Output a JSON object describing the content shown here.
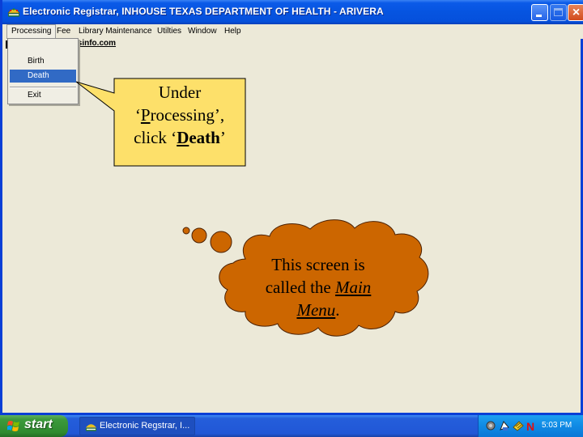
{
  "window": {
    "title": "Electronic Registrar, INHOUSE TEXAS DEPARTMENT OF HEALTH - ARIVERA",
    "controls": {
      "minimize": "minimize",
      "maximize": "maximize",
      "close": "×"
    }
  },
  "menubar": {
    "items": [
      {
        "label": "Processing",
        "active": true
      },
      {
        "label": "Fee"
      },
      {
        "label": "Library Maintenance"
      },
      {
        "label": "Utilties"
      },
      {
        "label": "Window"
      },
      {
        "label": "Help"
      }
    ]
  },
  "background_link": "isinfo.com",
  "dropdown": {
    "items": [
      {
        "label": "Birth",
        "selected": false
      },
      {
        "label": "Death",
        "selected": true
      },
      {
        "label": "Exit",
        "selected": false
      }
    ]
  },
  "callout": {
    "line1": "Under",
    "line2_quote_open": "‘",
    "line2_underlined": "P",
    "line2_rest": "rocessing’,",
    "line3_prefix": "click ‘",
    "line3_underlined": "D",
    "line3_bold_rest": "eath",
    "line3_quote_close": "’",
    "fill": "#fde06a",
    "border": "#000000"
  },
  "thought_cloud": {
    "line1": "This screen is",
    "line2_prefix": "called the ",
    "line2_italic": "Main",
    "line3_italic": "Menu",
    "line3_suffix": ".",
    "fill": "#cc6600"
  },
  "taskbar": {
    "start_label": "start",
    "task_button": "Electronic Regstrar, I...",
    "clock": "5:03 PM",
    "tray_icons": [
      "speaker-icon",
      "network-icon",
      "security-icon",
      "n-app-icon"
    ]
  }
}
